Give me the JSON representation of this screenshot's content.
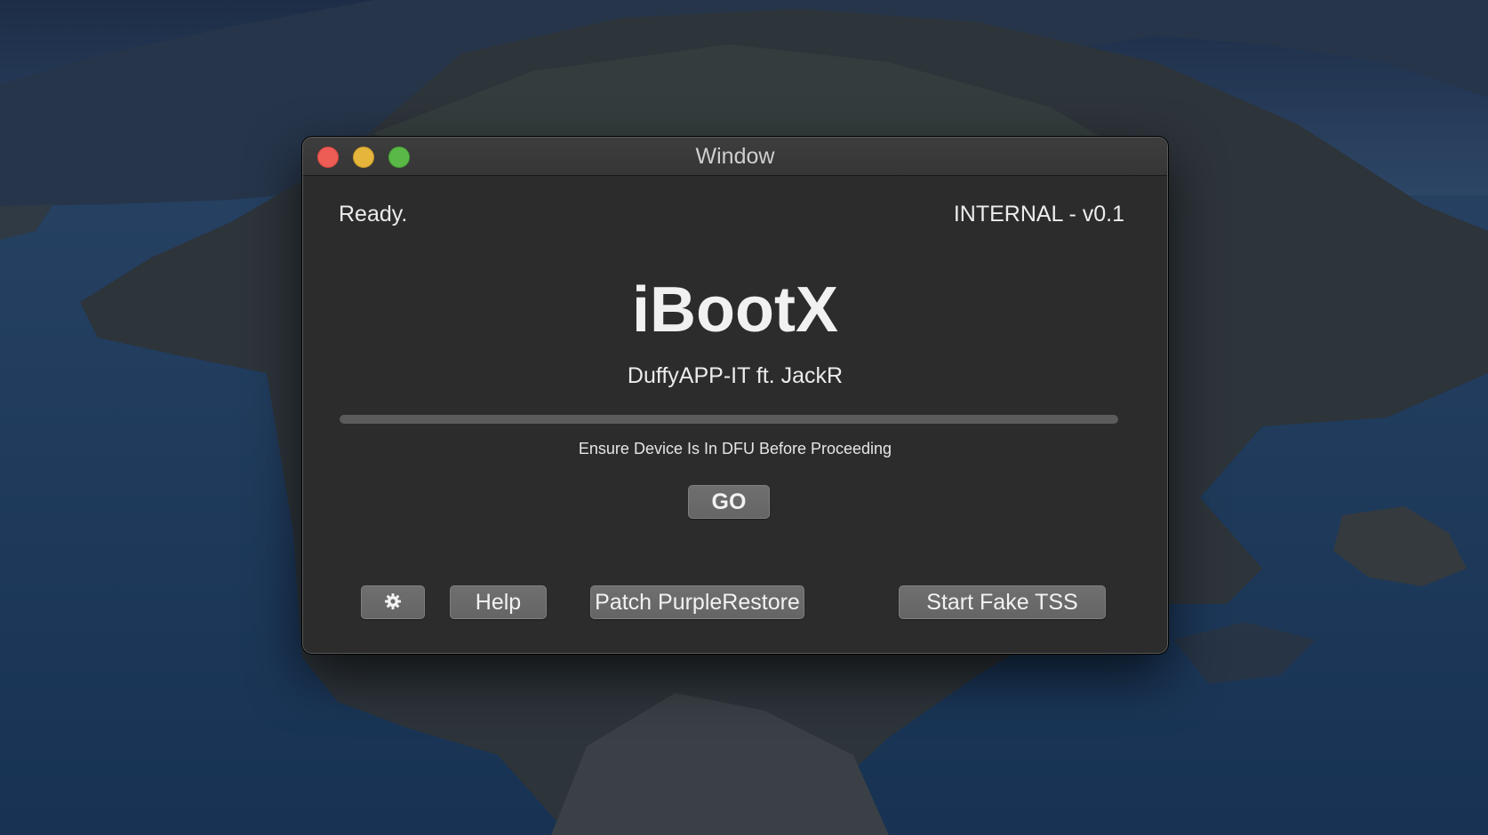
{
  "window": {
    "title": "Window"
  },
  "status": {
    "text": "Ready.",
    "version": "INTERNAL - v0.1"
  },
  "app": {
    "name": "iBootX",
    "credits": "DuffyAPP-IT ft. JackR"
  },
  "progress": {
    "fraction": 0,
    "track_color": "#5b5b5b"
  },
  "instruction": "Ensure Device Is In DFU Before Proceeding",
  "buttons": {
    "go": "GO",
    "settings_icon": "gear-icon",
    "help": "Help",
    "patch": "Patch PurpleRestore",
    "fake_tss": "Start Fake TSS"
  },
  "colors": {
    "close": "#ee5d55",
    "minimize": "#e6b53c",
    "maximize": "#5ab946",
    "window_bg": "#2c2c2c",
    "button_bg": "#6a6a6a"
  }
}
